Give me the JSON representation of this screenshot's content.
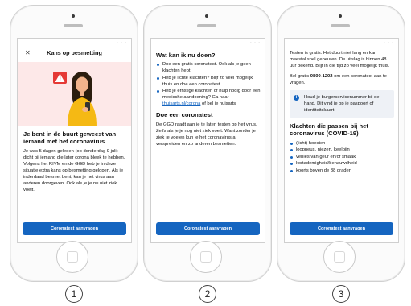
{
  "screen1": {
    "close_glyph": "✕",
    "title": "Kans op besmetting",
    "heading": "Je bent in de buurt geweest van iemand met het coronavirus",
    "body": "Je was 5 dagen geleden (op donderdag 9 juli) dicht bij iemand die later corona bleek te hebben. Volgens het RIVM en de GGD heb je in deze situatie extra kans op besmetting gelopen. Als je inderdaad besmet bent, kan je het virus aan anderen doorgeven. Ook als je je nu niet ziek voelt.",
    "button": "Coronatest aanvragen",
    "illustration": "person-with-phone-warning-illustration",
    "colors": {
      "banner_bg": "#fde8e8",
      "warning": "#e53935",
      "hair": "#2b1d0e",
      "shirt": "#f5b914"
    }
  },
  "screen2": {
    "heading": "Wat kan ik nu doen?",
    "bullets": [
      "Doe een gratis coronatest. Ook als je geen klachten hebt",
      "Heb je lichte klachten? Blijf zo veel mogelijk thuis en doe een coronatest",
      "Heb je ernstige klachten of hulp nodig door een medische aandoening? Ga naar"
    ],
    "bullet3_link": "thuisarts.nl/corona",
    "bullet3_tail": " of bel je huisarts",
    "heading2": "Doe een coronatest",
    "body": "De GGD raadt aan je te laten testen op het virus. Zelfs als je je nog niet ziek voelt. Want zonder je ziek te voelen kun je het coronavirus al verspreiden en zo anderen besmetten.",
    "button": "Coronatest aanvragen"
  },
  "screen3": {
    "body1": "Testen is gratis. Het duurt niet lang en kan meestal snel gebeuren. De uitslag is binnen 48 uur bekend. Blijf in die tijd zo veel mogelijk thuis.",
    "body2_pre": "Bel gratis ",
    "phone": "0800-1202",
    "body2_post": " om een coronatest aan te vragen.",
    "info": "Houd je burgerservicenummer bij de hand. Dit vind je op je paspoort of identiteitskaart",
    "info_icon_glyph": "i",
    "heading": "Klachten die passen bij het coronavirus (COVID-19)",
    "bullets": [
      "(licht) hoesten",
      "loopneus, niezen, keelpijn",
      "verlies van geur en/of smaak",
      "kortademigheid/benauwdheid",
      "koorts boven de 38 graden"
    ],
    "button": "Coronatest aanvragen"
  },
  "status_dots": "• • •",
  "step_numbers": [
    "1",
    "2",
    "3"
  ],
  "accent": "#1565c0"
}
